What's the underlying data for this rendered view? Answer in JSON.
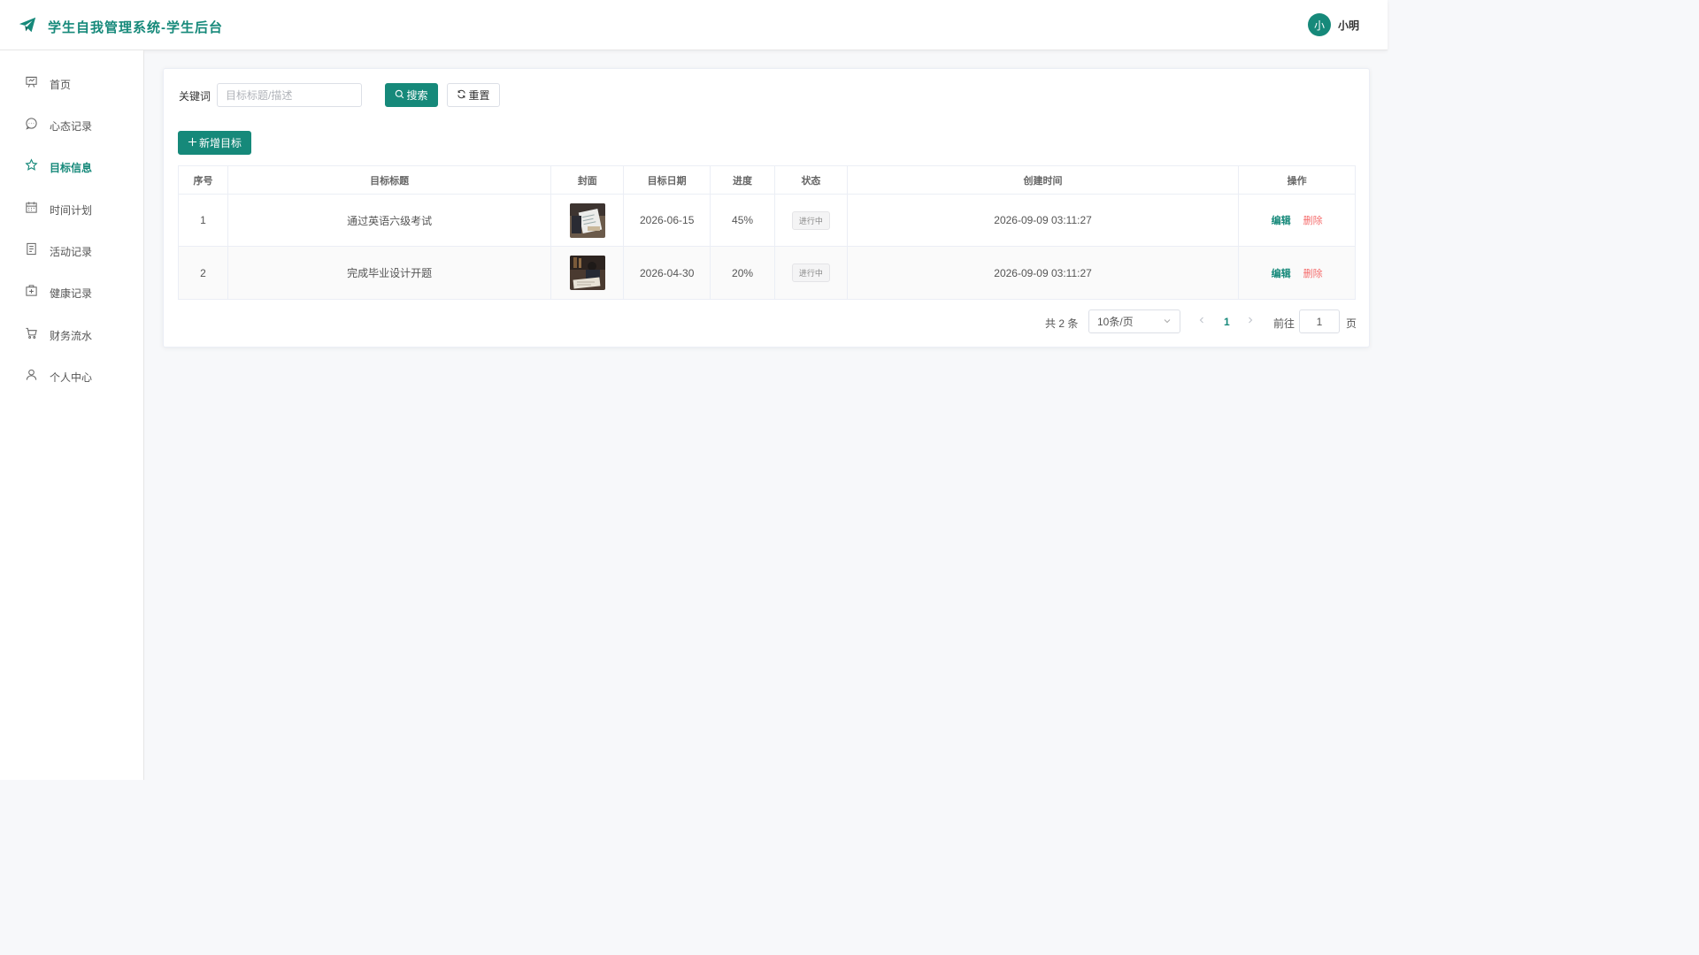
{
  "header": {
    "title": "学生自我管理系统-学生后台",
    "logo_icon": "paper-plane-icon",
    "user": {
      "avatar_text": "小",
      "name": "小明"
    }
  },
  "colors": {
    "accent": "#16897a",
    "danger": "#f56c6c"
  },
  "sidebar": {
    "items": [
      {
        "label": "首页",
        "icon": "presentation-icon",
        "active": false
      },
      {
        "label": "心态记录",
        "icon": "chat-bubble-icon",
        "active": false
      },
      {
        "label": "目标信息",
        "icon": "star-icon",
        "active": true
      },
      {
        "label": "时间计划",
        "icon": "calendar-icon",
        "active": false
      },
      {
        "label": "活动记录",
        "icon": "document-icon",
        "active": false
      },
      {
        "label": "健康记录",
        "icon": "medical-box-icon",
        "active": false
      },
      {
        "label": "财务流水",
        "icon": "cart-icon",
        "active": false
      },
      {
        "label": "个人中心",
        "icon": "user-icon",
        "active": false
      }
    ]
  },
  "search": {
    "label": "关键词",
    "placeholder": "目标标题/描述",
    "value": "",
    "search_button": "搜索",
    "reset_button": "重置"
  },
  "actions": {
    "add_button": "新增目标"
  },
  "table": {
    "columns": [
      "序号",
      "目标标题",
      "封面",
      "目标日期",
      "进度",
      "状态",
      "创建时间",
      "操作"
    ],
    "rows": [
      {
        "index": "1",
        "title": "通过英语六级考试",
        "date": "2026-06-15",
        "progress": "45%",
        "status": "进行中",
        "created": "2026-09-09 03:11:27",
        "edit": "编辑",
        "delete": "删除"
      },
      {
        "index": "2",
        "title": "完成毕业设计开题",
        "date": "2026-04-30",
        "progress": "20%",
        "status": "进行中",
        "created": "2026-09-09 03:11:27",
        "edit": "编辑",
        "delete": "删除"
      }
    ]
  },
  "pagination": {
    "total_text": "共 2 条",
    "page_size": "10条/页",
    "current_page": "1",
    "goto_label": "前往",
    "goto_value": "1",
    "page_suffix": "页"
  }
}
